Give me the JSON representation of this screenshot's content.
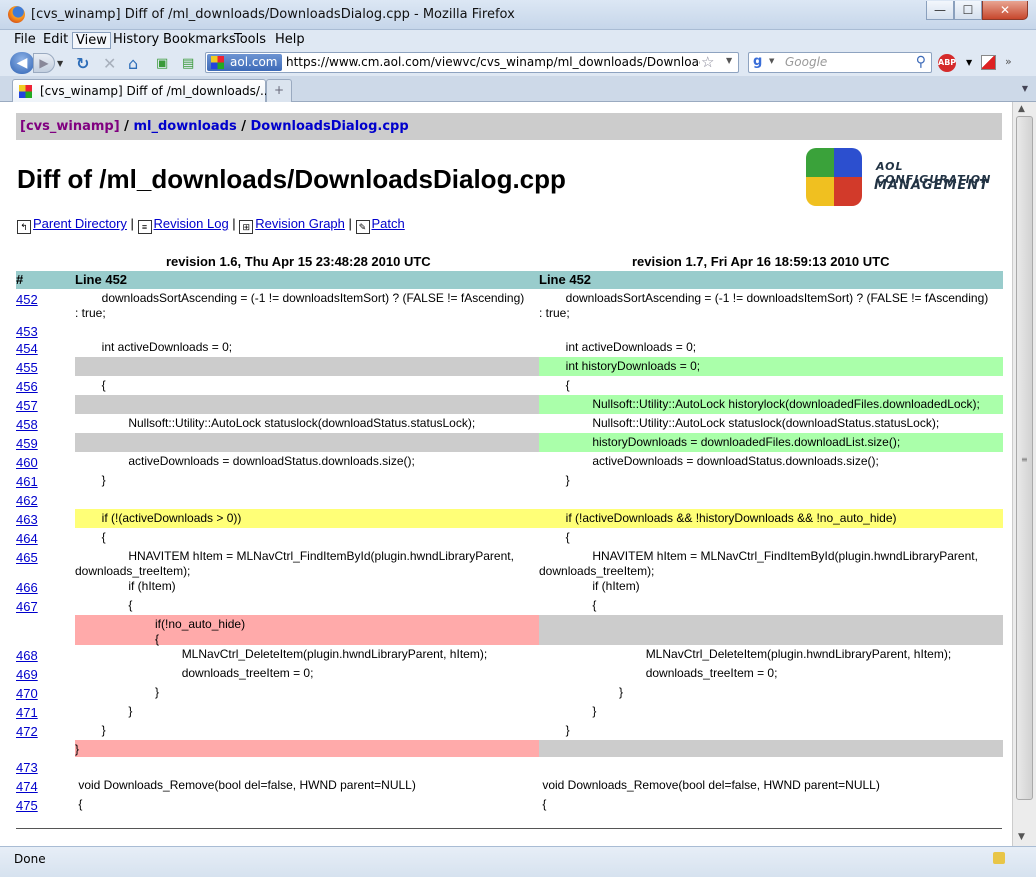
{
  "window": {
    "title": "[cvs_winamp] Diff of /ml_downloads/DownloadsDialog.cpp - Mozilla Firefox",
    "btn_min": "—",
    "btn_max": "☐",
    "btn_close": "✕"
  },
  "menu": [
    "File",
    "Edit",
    "View",
    "History",
    "Bookmarks",
    "Tools",
    "Help"
  ],
  "nav": {
    "site_badge": "aol.com",
    "url": "https://www.cm.aol.com/viewvc/cvs_winamp/ml_downloads/DownloadsDialog.cpp",
    "search_placeholder": "Google"
  },
  "tab": {
    "label": "[cvs_winamp] Diff of /ml_downloads/...",
    "new_tab": "+"
  },
  "breadcrumb": {
    "root": "[cvs_winamp]",
    "sep1": " / ",
    "dir": "ml_downloads",
    "sep2": " / ",
    "file": "DownloadsDialog.cpp"
  },
  "page": {
    "title": "Diff of /ml_downloads/DownloadsDialog.cpp"
  },
  "logo": {
    "line1": "AOL CONFIGURATION",
    "line2": "MANAGEMENT"
  },
  "links": {
    "parent": "Parent Directory",
    "log": "Revision Log",
    "graph": "Revision Graph",
    "patch": "Patch",
    "sep": " | "
  },
  "diff": {
    "rev_left": "revision 1.6, Thu Apr 15 23:48:28 2010 UTC",
    "rev_right": "revision 1.7, Fri Apr 16 18:59:13 2010 UTC",
    "hash_header": "#",
    "line_header_left": "Line 452",
    "line_header_right": "Line 452",
    "rows": [
      {
        "n": "452",
        "type": "same",
        "left": "        downloadsSortAscending = (-1 != downloadsItemSort) ? (FALSE != fAscending)\n: true;",
        "right": "        downloadsSortAscending = (-1 != downloadsItemSort) ? (FALSE != fAscending)\n: true;",
        "h": 32
      },
      {
        "n": "453",
        "type": "same",
        "left": "",
        "right": "",
        "h": 17
      },
      {
        "n": "454",
        "type": "same",
        "left": "        int activeDownloads = 0;",
        "right": "        int activeDownloads = 0;",
        "h": 19
      },
      {
        "n": "455",
        "type": "add",
        "left": "",
        "right": "        int historyDownloads = 0;",
        "h": 19
      },
      {
        "n": "456",
        "type": "same",
        "left": "        {",
        "right": "        {",
        "h": 19
      },
      {
        "n": "457",
        "type": "add",
        "left": "",
        "right": "                Nullsoft::Utility::AutoLock historylock(downloadedFiles.downloadedLock);",
        "h": 19
      },
      {
        "n": "458",
        "type": "same",
        "left": "                Nullsoft::Utility::AutoLock statuslock(downloadStatus.statusLock);",
        "right": "                Nullsoft::Utility::AutoLock statuslock(downloadStatus.statusLock);",
        "h": 19
      },
      {
        "n": "459",
        "type": "add",
        "left": "",
        "right": "                historyDownloads = downloadedFiles.downloadList.size();",
        "h": 19
      },
      {
        "n": "460",
        "type": "same",
        "left": "                activeDownloads = downloadStatus.downloads.size();",
        "right": "                activeDownloads = downloadStatus.downloads.size();",
        "h": 19
      },
      {
        "n": "461",
        "type": "same",
        "left": "        }",
        "right": "        }",
        "h": 19
      },
      {
        "n": "462",
        "type": "same",
        "left": "",
        "right": "",
        "h": 19
      },
      {
        "n": "463",
        "type": "change",
        "left": "        if (!(activeDownloads > 0))",
        "right": "        if (!activeDownloads && !historyDownloads && !no_auto_hide)",
        "h": 19
      },
      {
        "n": "464",
        "type": "same",
        "left": "        {",
        "right": "        {",
        "h": 19
      },
      {
        "n": "465",
        "type": "same",
        "left": "                HNAVITEM hItem = MLNavCtrl_FindItemById(plugin.hwndLibraryParent,\ndownloads_treeItem);",
        "right": "                HNAVITEM hItem = MLNavCtrl_FindItemById(plugin.hwndLibraryParent,\ndownloads_treeItem);",
        "h": 30
      },
      {
        "n": "466",
        "type": "same",
        "left": "                if (hItem)",
        "right": "                if (hItem)",
        "h": 19
      },
      {
        "n": "467",
        "type": "same",
        "left": "                {",
        "right": "                {",
        "h": 19
      },
      {
        "n": "",
        "type": "remove",
        "left": "                        if(!no_auto_hide)\n                        {",
        "right": "",
        "h": 30
      },
      {
        "n": "468",
        "type": "same",
        "left": "                                MLNavCtrl_DeleteItem(plugin.hwndLibraryParent, hItem);",
        "right": "                                MLNavCtrl_DeleteItem(plugin.hwndLibraryParent, hItem);",
        "h": 19
      },
      {
        "n": "469",
        "type": "same",
        "left": "                                downloads_treeItem = 0;",
        "right": "                                downloads_treeItem = 0;",
        "h": 19
      },
      {
        "n": "470",
        "type": "same",
        "left": "                        }",
        "right": "                        }",
        "h": 19
      },
      {
        "n": "471",
        "type": "same",
        "left": "                }",
        "right": "                }",
        "h": 19
      },
      {
        "n": "472",
        "type": "same",
        "left": "        }",
        "right": "        }",
        "h": 19
      },
      {
        "n": "",
        "type": "remove",
        "left": "}",
        "right": "",
        "h": 17
      },
      {
        "n": "473",
        "type": "same",
        "left": "",
        "right": "",
        "h": 19
      },
      {
        "n": "474",
        "type": "same",
        "left": " void Downloads_Remove(bool del=false, HWND parent=NULL)",
        "right": " void Downloads_Remove(bool del=false, HWND parent=NULL)",
        "h": 19
      },
      {
        "n": "475",
        "type": "same",
        "left": " {",
        "right": " {",
        "h": 19
      }
    ]
  },
  "status": "Done"
}
